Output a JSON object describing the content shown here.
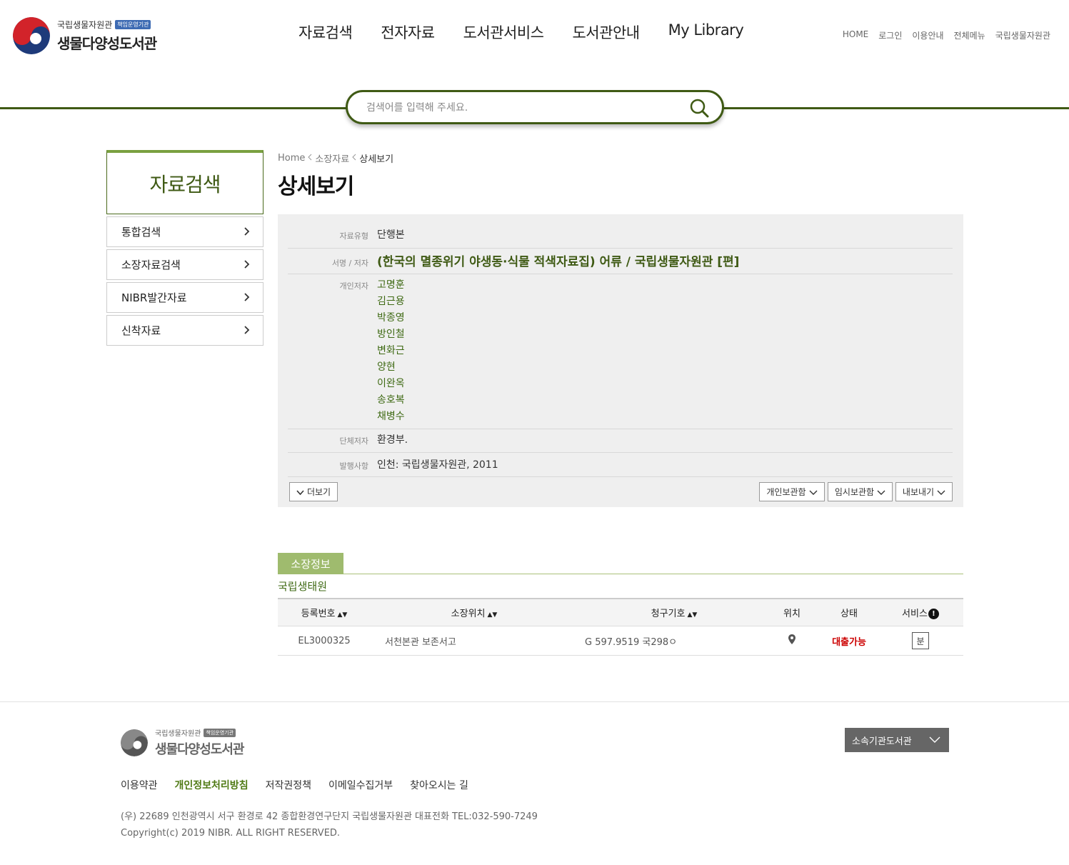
{
  "header": {
    "logo_sub": "국립생물자원관",
    "logo_badge": "책임운영기관",
    "logo_main": "생물다양성도서관",
    "gnb": [
      "자료검색",
      "전자자료",
      "도서관서비스",
      "도서관안내",
      "My Library"
    ],
    "util": [
      "HOME",
      "로그인",
      "이용안내",
      "전체메뉴",
      "국립생물자원관"
    ]
  },
  "search": {
    "placeholder": "검색어를 입력해 주세요."
  },
  "lnb": {
    "title": "자료검색",
    "items": [
      "통합검색",
      "소장자료검색",
      "NIBR발간자료",
      "신착자료"
    ]
  },
  "breadcrumb": {
    "home": "Home",
    "level1": "소장자료",
    "current": "상세보기"
  },
  "page_title": "상세보기",
  "detail": {
    "type_label": "자료유형",
    "type_value": "단행본",
    "title_label": "서명 / 저자",
    "title_value": "(한국의 멸종위기 야생동·식물 적색자료집) 어류 / 국립생물자원관 [편]",
    "authors_label": "개인저자",
    "authors": [
      "고명훈",
      "김근용",
      "박종영",
      "방인철",
      "변화근",
      "양현",
      "이완옥",
      "송호복",
      "채병수"
    ],
    "corp_label": "단체저자",
    "corp_value": "환경부.",
    "pub_label": "발행사항",
    "pub_value": "인천: 국립생물자원관, 2011",
    "more_button": "더보기",
    "buttons": [
      "개인보관함",
      "임시보관함",
      "내보내기"
    ]
  },
  "holdings": {
    "tab": "소장정보",
    "library": "국립생태원",
    "headers": [
      "등록번호",
      "소장위치",
      "청구기호",
      "위치",
      "상태",
      "서비스"
    ],
    "rows": [
      {
        "reg_no": "EL3000325",
        "location": "서천본관 보존서고",
        "call_no": "G 597.9519 국298ㅇ",
        "status": "대출가능",
        "service": "분"
      }
    ]
  },
  "footer": {
    "logo_sub": "국립생물자원관",
    "logo_badge": "책임운영기관",
    "logo_main": "생물다양성도서관",
    "family": "소속기관도서관",
    "links": [
      "이용약관",
      "개인정보처리방침",
      "저작권정책",
      "이메일수집거부",
      "찾아오시는 길"
    ],
    "address": "(우) 22689 인천광역시 서구 환경로 42 종합환경연구단지 국립생물자원관 대표전화 TEL:032-590-7249",
    "copyright": "Copyright(c) 2019 NIBR. ALL RIGHT RESERVED."
  },
  "colors": {
    "brand_green": "#3f5a14",
    "light_green": "#9fbb6e",
    "status_red": "#cc0000"
  }
}
